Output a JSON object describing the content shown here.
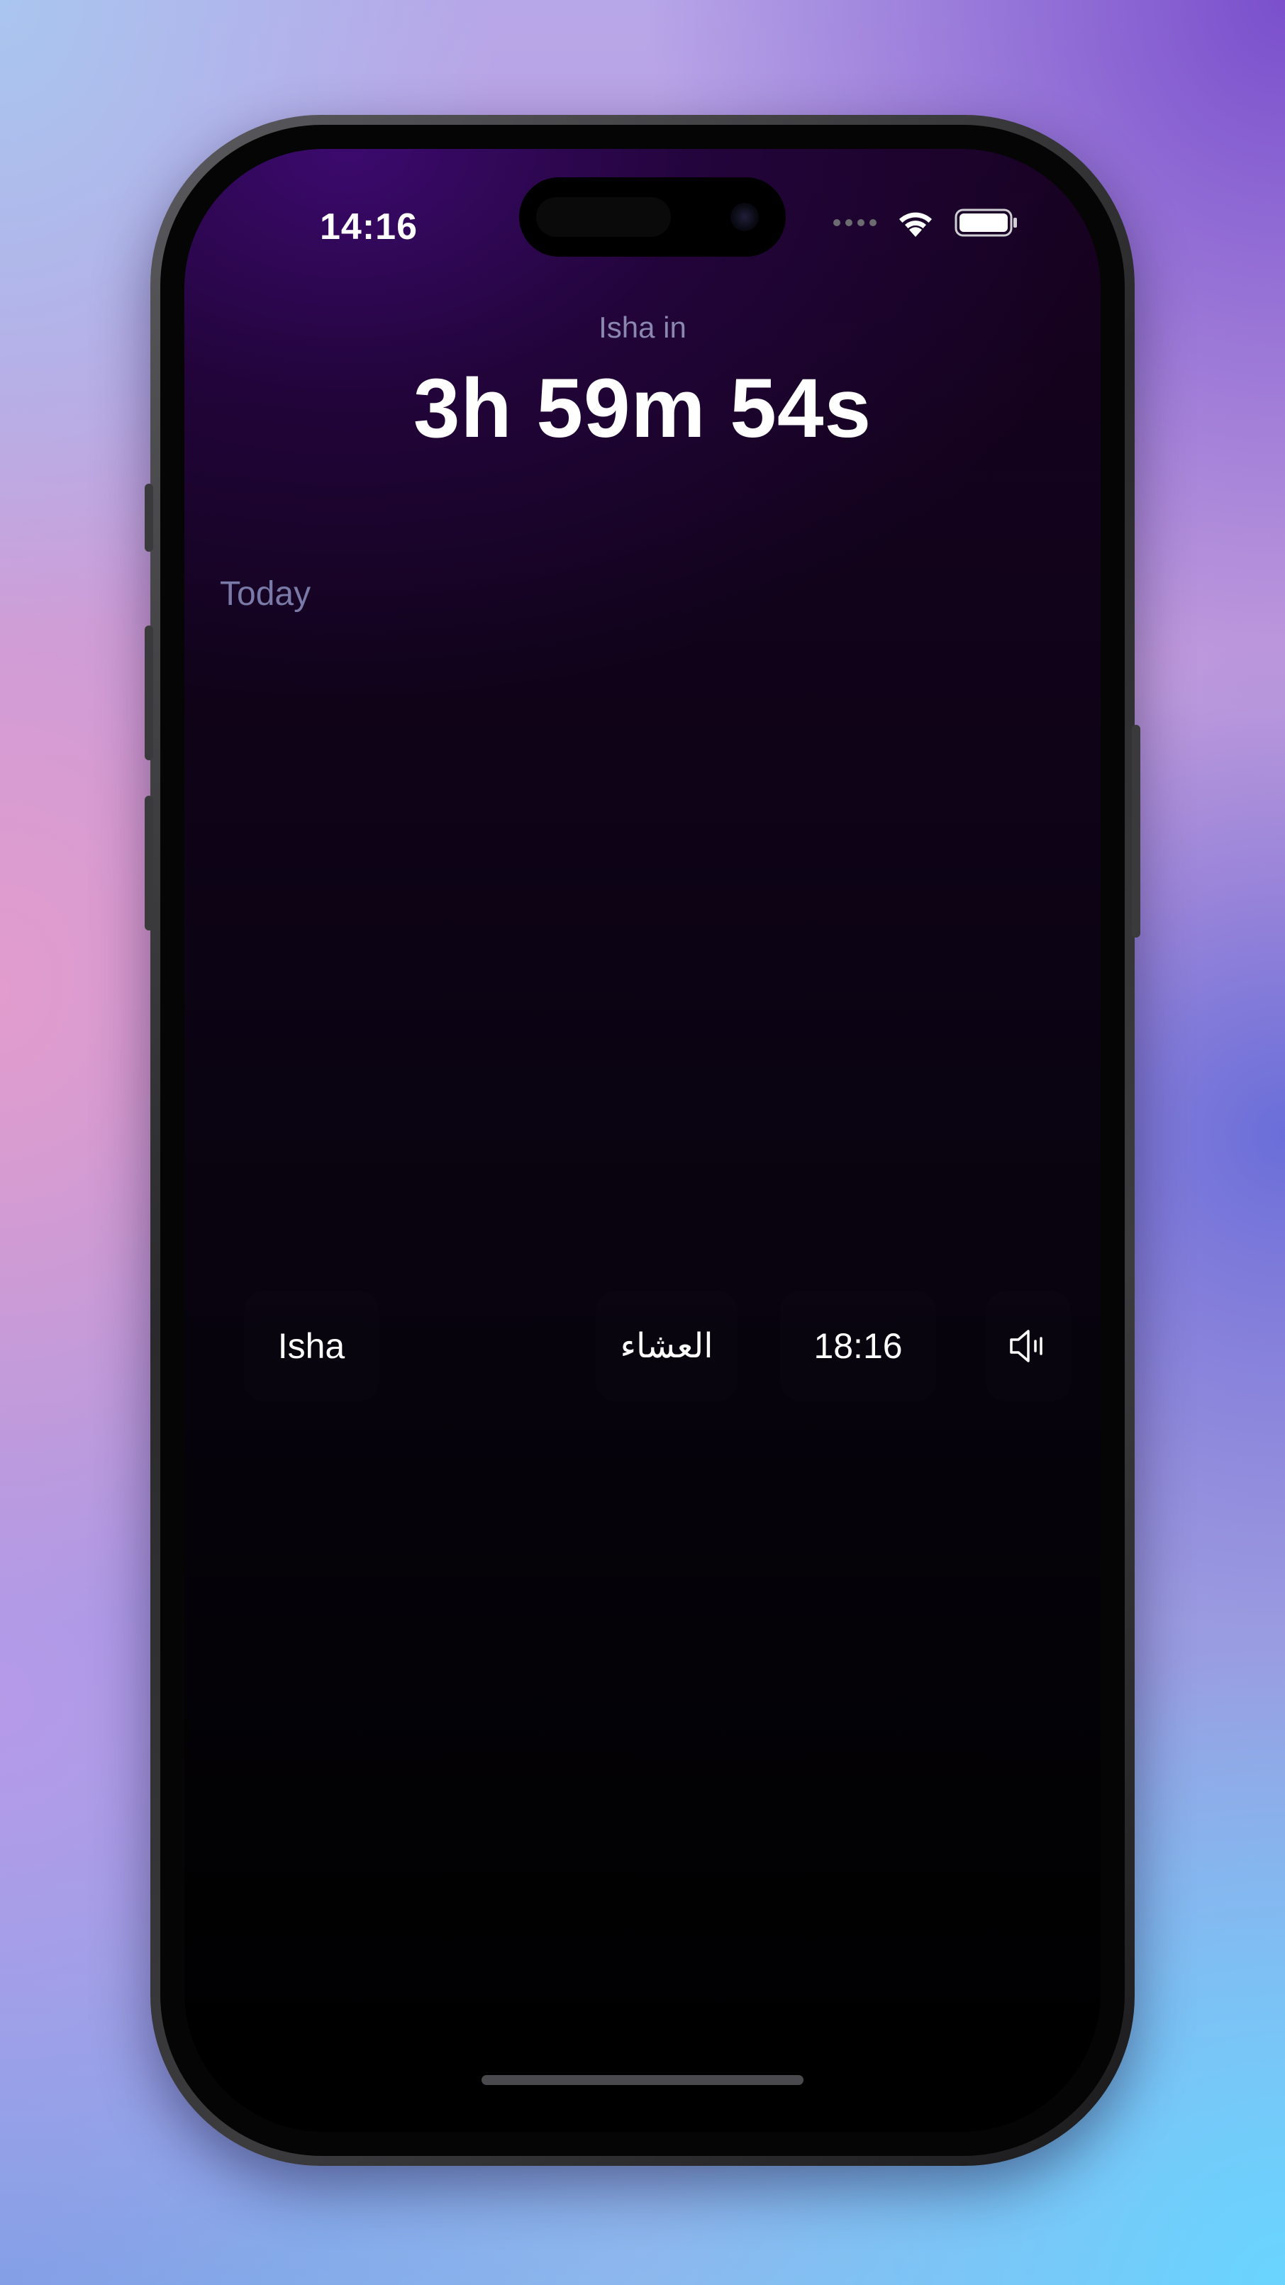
{
  "status_bar": {
    "time": "14:16",
    "icons": [
      "cellular-signal-icon",
      "wifi-icon",
      "battery-icon"
    ]
  },
  "next_prayer": {
    "label": "Isha in",
    "countdown": "3h 59m 54s"
  },
  "section": {
    "title": "Today"
  },
  "prayers": [
    {
      "name": "Isha",
      "arabic": "العشاء",
      "time": "18:16",
      "icon": "speaker-icon"
    }
  ],
  "colors": {
    "accent_purple": "#3c0a6e",
    "label_muted": "#8a88b0",
    "section_title": "#7a7aa8",
    "text_primary": "#ffffff"
  }
}
